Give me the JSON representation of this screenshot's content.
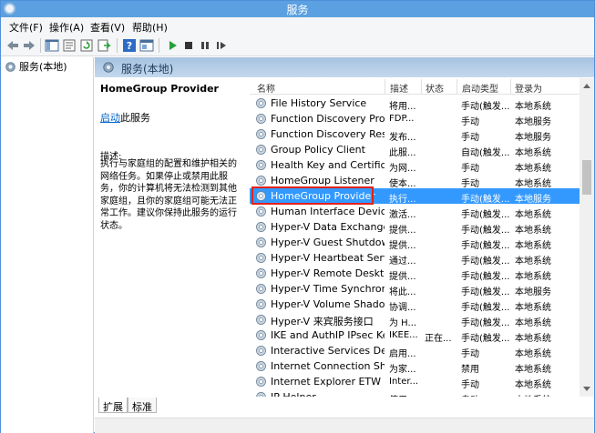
{
  "window": {
    "title": "服务"
  },
  "menu": [
    {
      "label": "文件(F)"
    },
    {
      "label": "操作(A)"
    },
    {
      "label": "查看(V)"
    },
    {
      "label": "帮助(H)"
    }
  ],
  "toolbar": {
    "icons": [
      "back-arrow-icon",
      "forward-arrow-icon",
      "show-console-tree-icon",
      "properties-icon",
      "refresh-icon",
      "export-list-icon",
      "help-icon",
      "view-icon",
      "start-service-icon",
      "stop-service-icon",
      "pause-service-icon",
      "restart-service-icon"
    ]
  },
  "tree": {
    "root_label": "服务(本地)"
  },
  "pane_header": {
    "title": "服务(本地)"
  },
  "detail": {
    "service_title": "HomeGroup Provider",
    "start_link": "启动",
    "start_suffix": "此服务",
    "desc_label": "描述:",
    "desc_text": "执行与家庭组的配置和维护相关的网络任务。如果停止或禁用此服务，你的计算机将无法检测到其他家庭组，且你的家庭组可能无法正常工作。建议你保持此服务的运行状态。"
  },
  "columns": {
    "name": "名称",
    "desc": "描述",
    "state": "状态",
    "start": "启动类型",
    "logon": "登录为"
  },
  "rows": [
    {
      "name": "File History Service",
      "desc": "将用...",
      "state": "",
      "start": "手动(触发...",
      "logon": "本地系统"
    },
    {
      "name": "Function Discovery Provi...",
      "desc": "FDP...",
      "state": "",
      "start": "手动",
      "logon": "本地服务"
    },
    {
      "name": "Function Discovery Reso...",
      "desc": "发布...",
      "state": "",
      "start": "手动",
      "logon": "本地服务"
    },
    {
      "name": "Group Policy Client",
      "desc": "此服...",
      "state": "",
      "start": "自动(触发...",
      "logon": "本地系统"
    },
    {
      "name": "Health Key and Certificat...",
      "desc": "为网...",
      "state": "",
      "start": "手动",
      "logon": "本地系统"
    },
    {
      "name": "HomeGroup Listener",
      "desc": "使本...",
      "state": "",
      "start": "手动",
      "logon": "本地系统"
    },
    {
      "name": "HomeGroup Provider",
      "desc": "执行...",
      "state": "",
      "start": "手动(触发...",
      "logon": "本地服务"
    },
    {
      "name": "Human Interface Device ...",
      "desc": "激活...",
      "state": "",
      "start": "手动(触发...",
      "logon": "本地系统"
    },
    {
      "name": "Hyper-V Data Exchange ...",
      "desc": "提供...",
      "state": "",
      "start": "手动(触发...",
      "logon": "本地系统"
    },
    {
      "name": "Hyper-V Guest Shutdown...",
      "desc": "提供...",
      "state": "",
      "start": "手动(触发...",
      "logon": "本地系统"
    },
    {
      "name": "Hyper-V Heartbeat Service",
      "desc": "通过...",
      "state": "",
      "start": "手动(触发...",
      "logon": "本地系统"
    },
    {
      "name": "Hyper-V Remote Deskto...",
      "desc": "提供...",
      "state": "",
      "start": "手动(触发...",
      "logon": "本地系统"
    },
    {
      "name": "Hyper-V Time Synchroniz...",
      "desc": "将此...",
      "state": "",
      "start": "手动(触发...",
      "logon": "本地服务"
    },
    {
      "name": "Hyper-V Volume Shadow...",
      "desc": "协调...",
      "state": "",
      "start": "手动(触发...",
      "logon": "本地系统"
    },
    {
      "name": "Hyper-V 来宾服务接口",
      "desc": "为 H...",
      "state": "",
      "start": "手动(触发...",
      "logon": "本地系统"
    },
    {
      "name": "IKE and AuthIP IPsec Key...",
      "desc": "IKEE...",
      "state": "正在...",
      "start": "手动(触发...",
      "logon": "本地系统"
    },
    {
      "name": "Interactive Services Dete...",
      "desc": "启用...",
      "state": "",
      "start": "手动",
      "logon": "本地系统"
    },
    {
      "name": "Internet Connection Shari...",
      "desc": "为家...",
      "state": "",
      "start": "禁用",
      "logon": "本地系统"
    },
    {
      "name": "Internet Explorer ETW C...",
      "desc": "Inter...",
      "state": "",
      "start": "手动",
      "logon": "本地系统"
    },
    {
      "name": "IP Helper",
      "desc": "使用...",
      "state": "",
      "start": "自动",
      "logon": "本地系统"
    }
  ],
  "selected_row": 6,
  "tabs": [
    {
      "label": "扩展"
    },
    {
      "label": "标准"
    }
  ],
  "colors": {
    "title_bar": "#5ba0e0",
    "selection": "#3399ff",
    "highlight_box": "#e0221a",
    "link": "#0066cc"
  }
}
